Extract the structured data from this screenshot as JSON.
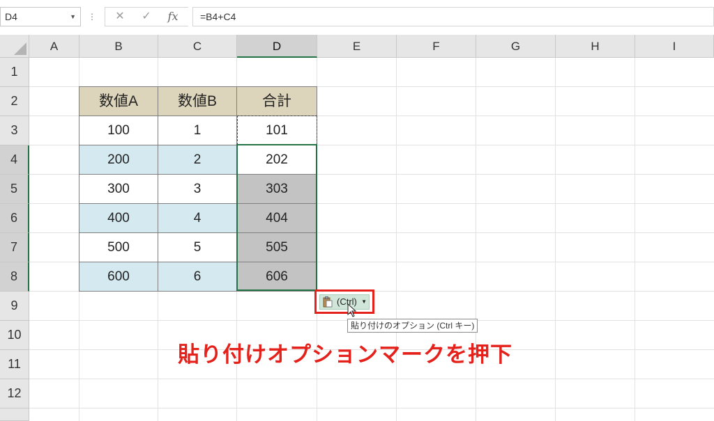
{
  "formula_bar": {
    "name_box": "D4",
    "more_glyph": "⋮",
    "cancel_glyph": "✕",
    "enter_glyph": "✓",
    "fx_label": "fx",
    "formula": "=B4+C4"
  },
  "columns": [
    "A",
    "B",
    "C",
    "D",
    "E",
    "F",
    "G",
    "H",
    "I"
  ],
  "rows": [
    "1",
    "2",
    "3",
    "4",
    "5",
    "6",
    "7",
    "8",
    "9",
    "10",
    "11",
    "12",
    ""
  ],
  "table": {
    "headers": [
      "数値A",
      "数値B",
      "合計"
    ],
    "rows": [
      [
        "100",
        "1",
        "101"
      ],
      [
        "200",
        "2",
        "202"
      ],
      [
        "300",
        "3",
        "303"
      ],
      [
        "400",
        "4",
        "404"
      ],
      [
        "500",
        "5",
        "505"
      ],
      [
        "600",
        "6",
        "606"
      ]
    ]
  },
  "paste_options": {
    "label": "(Ctrl)",
    "tooltip": "貼り付けのオプション (Ctrl キー)"
  },
  "annotation": "貼り付けオプションマークを押下",
  "colors": {
    "header_fill": "#ddd5bb",
    "band_fill": "#d5e9f0",
    "selected_fill": "#c3c3c3",
    "accent_green": "#217346",
    "annotation_red": "#e4211b"
  }
}
